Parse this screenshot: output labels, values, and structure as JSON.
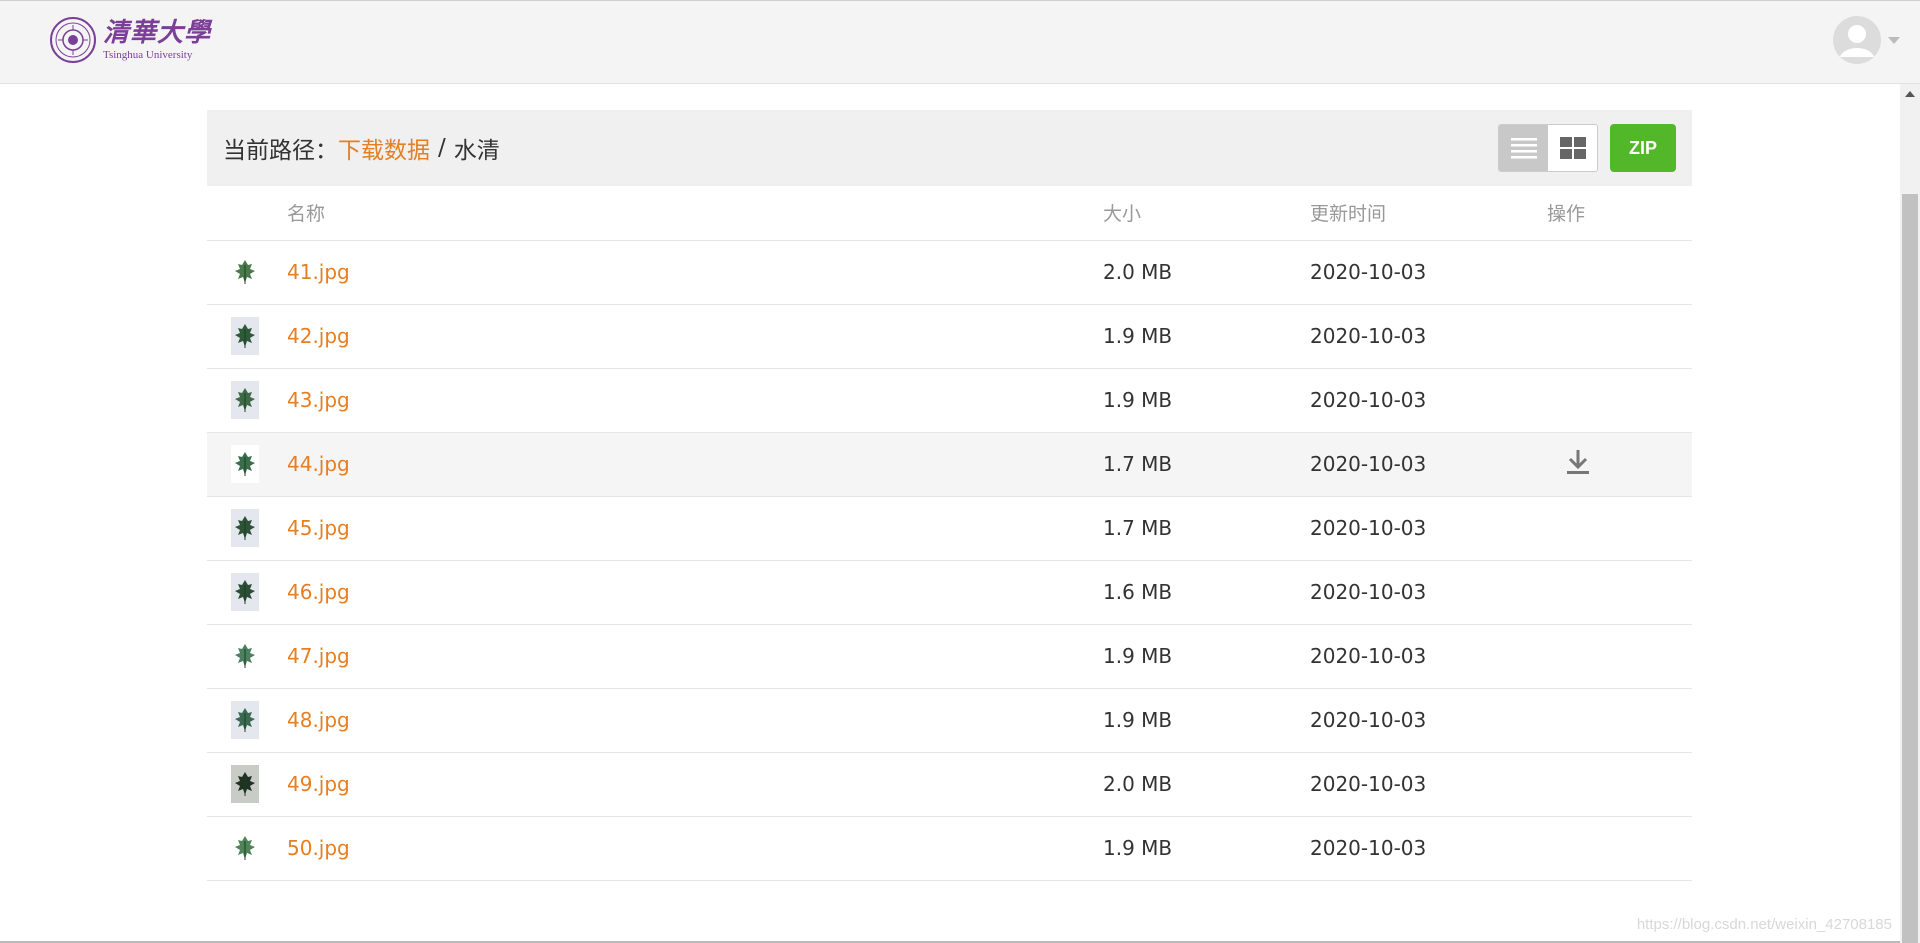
{
  "header": {
    "logo_cn": "清華大學",
    "logo_en": "Tsinghua University"
  },
  "path": {
    "label": "当前路径：",
    "crumbs": [
      {
        "text": "下载数据",
        "link": true
      },
      {
        "text": "水清",
        "link": false
      }
    ],
    "separator": "/"
  },
  "toolbar": {
    "zip_label": "ZIP"
  },
  "table": {
    "headers": {
      "name": "名称",
      "size": "大小",
      "time": "更新时间",
      "action": "操作"
    },
    "rows": [
      {
        "name": "41.jpg",
        "size": "2.0 MB",
        "time": "2020-10-03"
      },
      {
        "name": "42.jpg",
        "size": "1.9 MB",
        "time": "2020-10-03"
      },
      {
        "name": "43.jpg",
        "size": "1.9 MB",
        "time": "2020-10-03"
      },
      {
        "name": "44.jpg",
        "size": "1.7 MB",
        "time": "2020-10-03"
      },
      {
        "name": "45.jpg",
        "size": "1.7 MB",
        "time": "2020-10-03"
      },
      {
        "name": "46.jpg",
        "size": "1.6 MB",
        "time": "2020-10-03"
      },
      {
        "name": "47.jpg",
        "size": "1.9 MB",
        "time": "2020-10-03"
      },
      {
        "name": "48.jpg",
        "size": "1.9 MB",
        "time": "2020-10-03"
      },
      {
        "name": "49.jpg",
        "size": "2.0 MB",
        "time": "2020-10-03"
      },
      {
        "name": "50.jpg",
        "size": "1.9 MB",
        "time": "2020-10-03"
      }
    ]
  },
  "watermark": "https://blog.csdn.net/weixin_42708185",
  "colors": {
    "accent": "#e67e22",
    "zip_green": "#52b829",
    "logo_purple": "#7b3f98"
  },
  "icons": {
    "list_view": "list-view-icon",
    "grid_view": "grid-view-icon",
    "download": "download-icon",
    "thumbnail": "leaf-thumbnail-icon",
    "avatar": "user-avatar-icon"
  }
}
